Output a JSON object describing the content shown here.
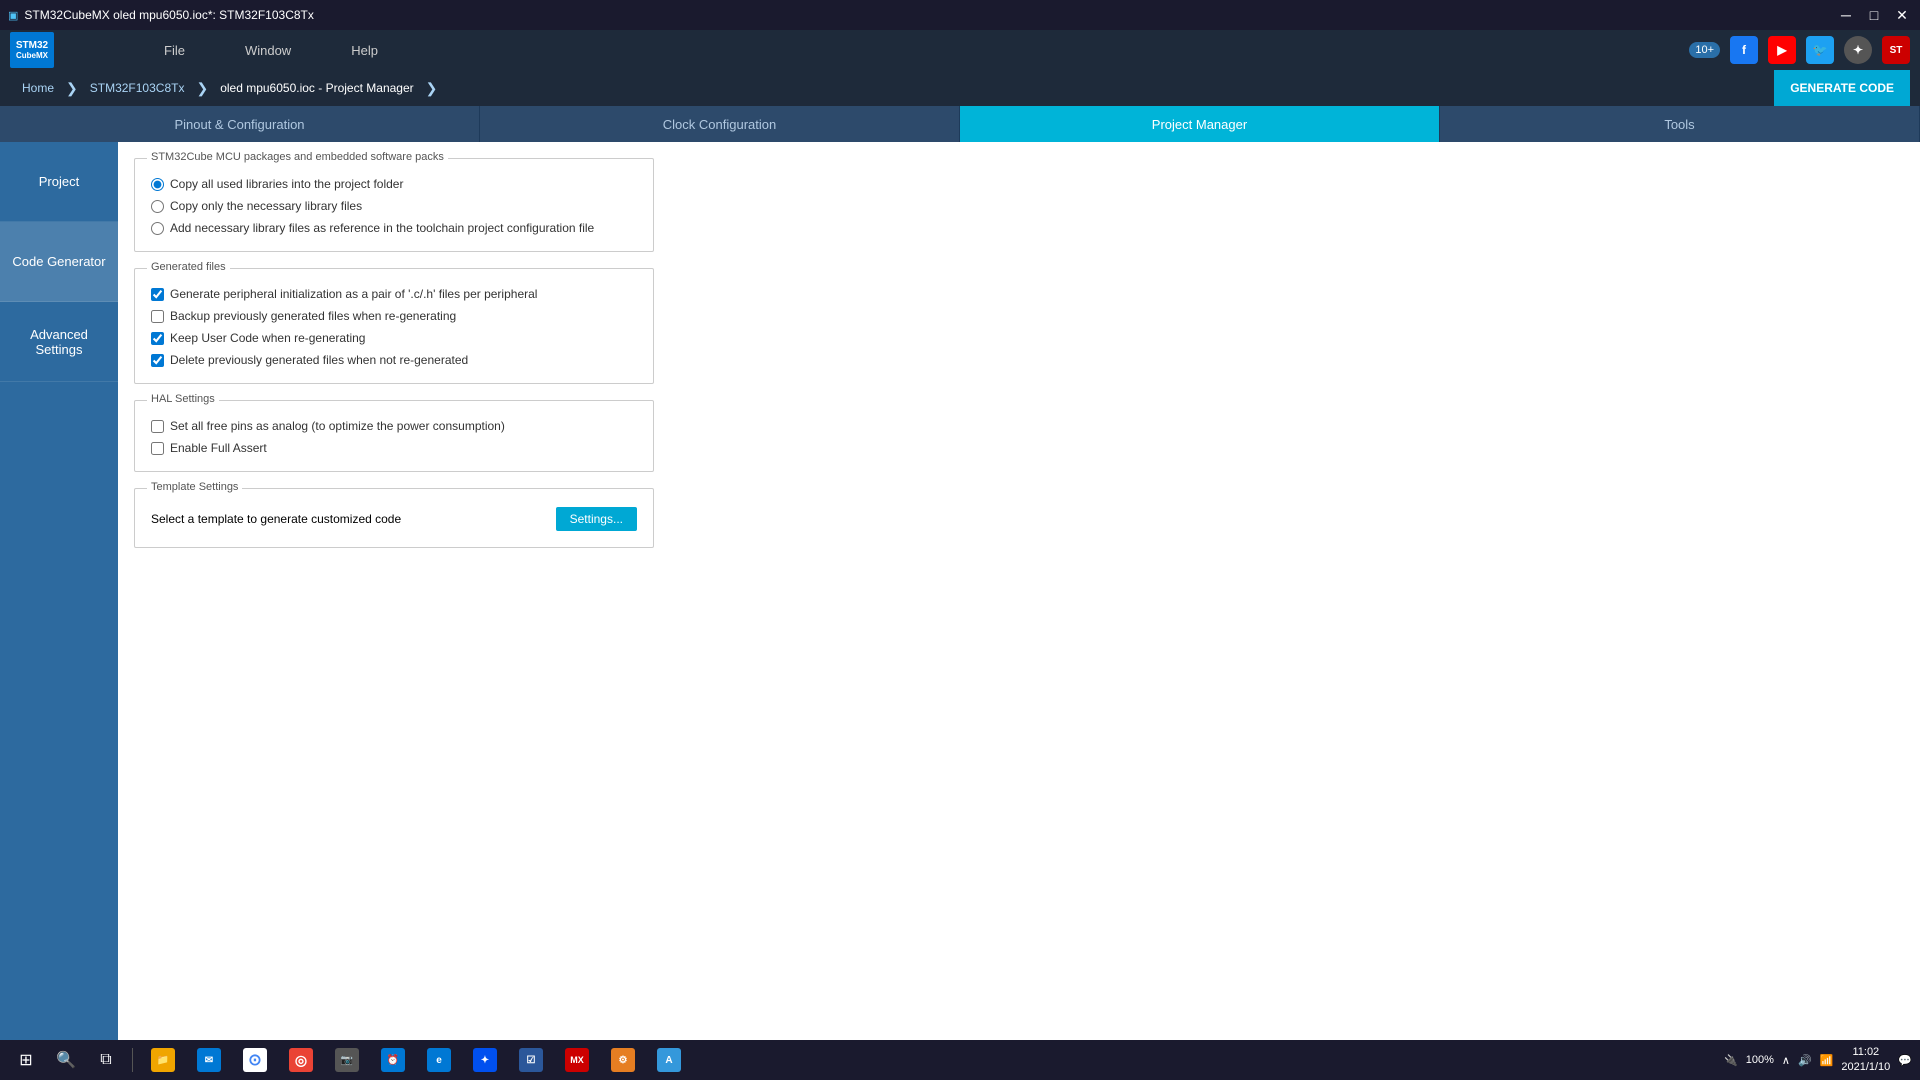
{
  "window": {
    "title": "STM32CubeMX oled mpu6050.ioc*: STM32F103C8Tx"
  },
  "menubar": {
    "file": "File",
    "window": "Window",
    "help": "Help",
    "version": "10+"
  },
  "breadcrumb": {
    "home": "Home",
    "chip": "STM32F103C8Tx",
    "project": "oled mpu6050.ioc - Project Manager",
    "generate_btn": "GENERATE CODE"
  },
  "tabs": [
    {
      "id": "pinout",
      "label": "Pinout & Configuration",
      "active": false
    },
    {
      "id": "clock",
      "label": "Clock Configuration",
      "active": false
    },
    {
      "id": "project_manager",
      "label": "Project Manager",
      "active": true
    },
    {
      "id": "tools",
      "label": "Tools",
      "active": false
    }
  ],
  "sidebar": {
    "items": [
      {
        "id": "project",
        "label": "Project",
        "active": false
      },
      {
        "id": "code_generator",
        "label": "Code Generator",
        "active": true
      },
      {
        "id": "advanced_settings",
        "label": "Advanced Settings",
        "active": false
      }
    ]
  },
  "content": {
    "mcu_packages": {
      "legend": "STM32Cube MCU packages and embedded software packs",
      "options": [
        {
          "id": "copy_all",
          "label": "Copy all used libraries into the project folder",
          "selected": true
        },
        {
          "id": "copy_necessary",
          "label": "Copy only the necessary library files",
          "selected": false
        },
        {
          "id": "add_reference",
          "label": "Add necessary library files as reference in the toolchain project configuration file",
          "selected": false
        }
      ]
    },
    "generated_files": {
      "legend": "Generated files",
      "options": [
        {
          "id": "gen_peripheral",
          "label": "Generate peripheral initialization as a pair of '.c/.h' files per peripheral",
          "checked": true
        },
        {
          "id": "backup_files",
          "label": "Backup previously generated files when re-generating",
          "checked": false
        },
        {
          "id": "keep_user_code",
          "label": "Keep User Code when re-generating",
          "checked": true
        },
        {
          "id": "delete_prev",
          "label": "Delete previously generated files when not re-generated",
          "checked": true
        }
      ]
    },
    "hal_settings": {
      "legend": "HAL Settings",
      "options": [
        {
          "id": "set_analog",
          "label": "Set all free pins as analog (to optimize the power consumption)",
          "checked": false
        },
        {
          "id": "enable_full_assert",
          "label": "Enable Full Assert",
          "checked": false
        }
      ]
    },
    "template_settings": {
      "legend": "Template Settings",
      "description": "Select a template to generate customized code",
      "settings_btn": "Settings..."
    }
  },
  "taskbar": {
    "time": "11:02",
    "date": "2021/1/10",
    "battery": "100%"
  }
}
